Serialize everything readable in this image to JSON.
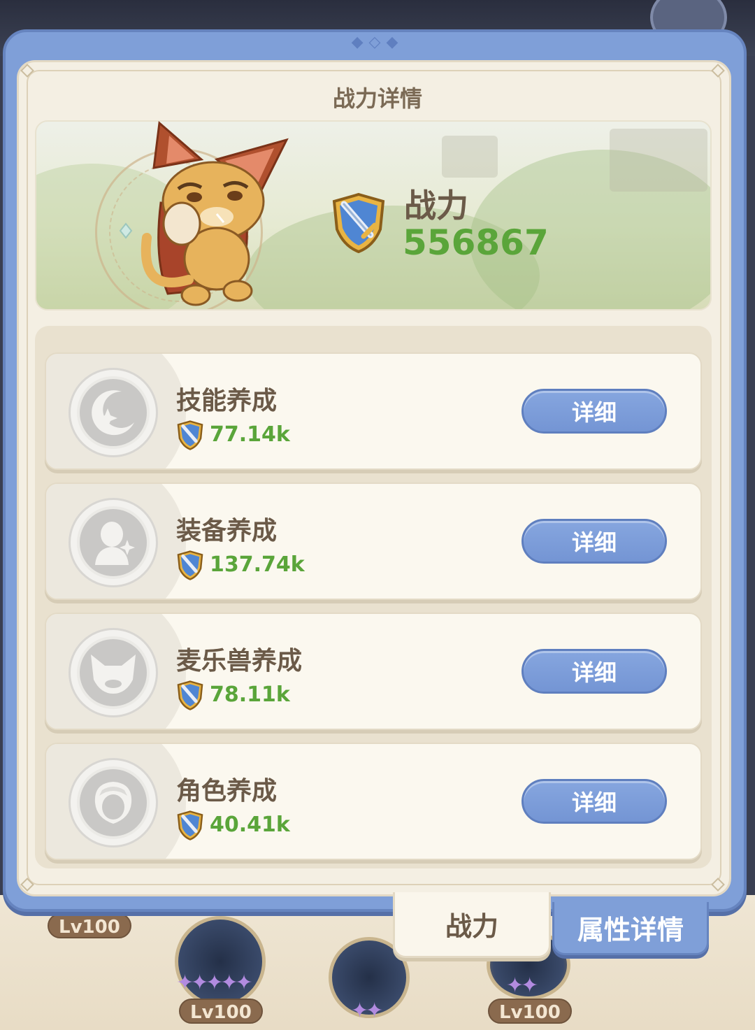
{
  "panel": {
    "title": "战力详情"
  },
  "summary": {
    "label": "战力",
    "value": "556867"
  },
  "categories": [
    {
      "name": "技能养成",
      "value": "77.14k",
      "button": "详细",
      "icon": "crescent-moon-sparkle-icon"
    },
    {
      "name": "装备养成",
      "value": "137.74k",
      "button": "详细",
      "icon": "armor-bust-sparkle-icon"
    },
    {
      "name": "麦乐兽养成",
      "value": "78.11k",
      "button": "详细",
      "icon": "cat-face-icon"
    },
    {
      "name": "角色养成",
      "value": "40.41k",
      "button": "详细",
      "icon": "character-head-icon"
    }
  ],
  "tabs": {
    "active": "战力",
    "other": "属性详情"
  },
  "background": {
    "lv_badges": [
      "Lv100",
      "Lv100",
      "Lv100"
    ]
  },
  "colors": {
    "panel_blue": "#7f9fd8",
    "panel_cream": "#f4efe3",
    "power_green": "#5aa53a",
    "text_brown": "#6b5a48",
    "button_blue": "#7f9fd8"
  }
}
